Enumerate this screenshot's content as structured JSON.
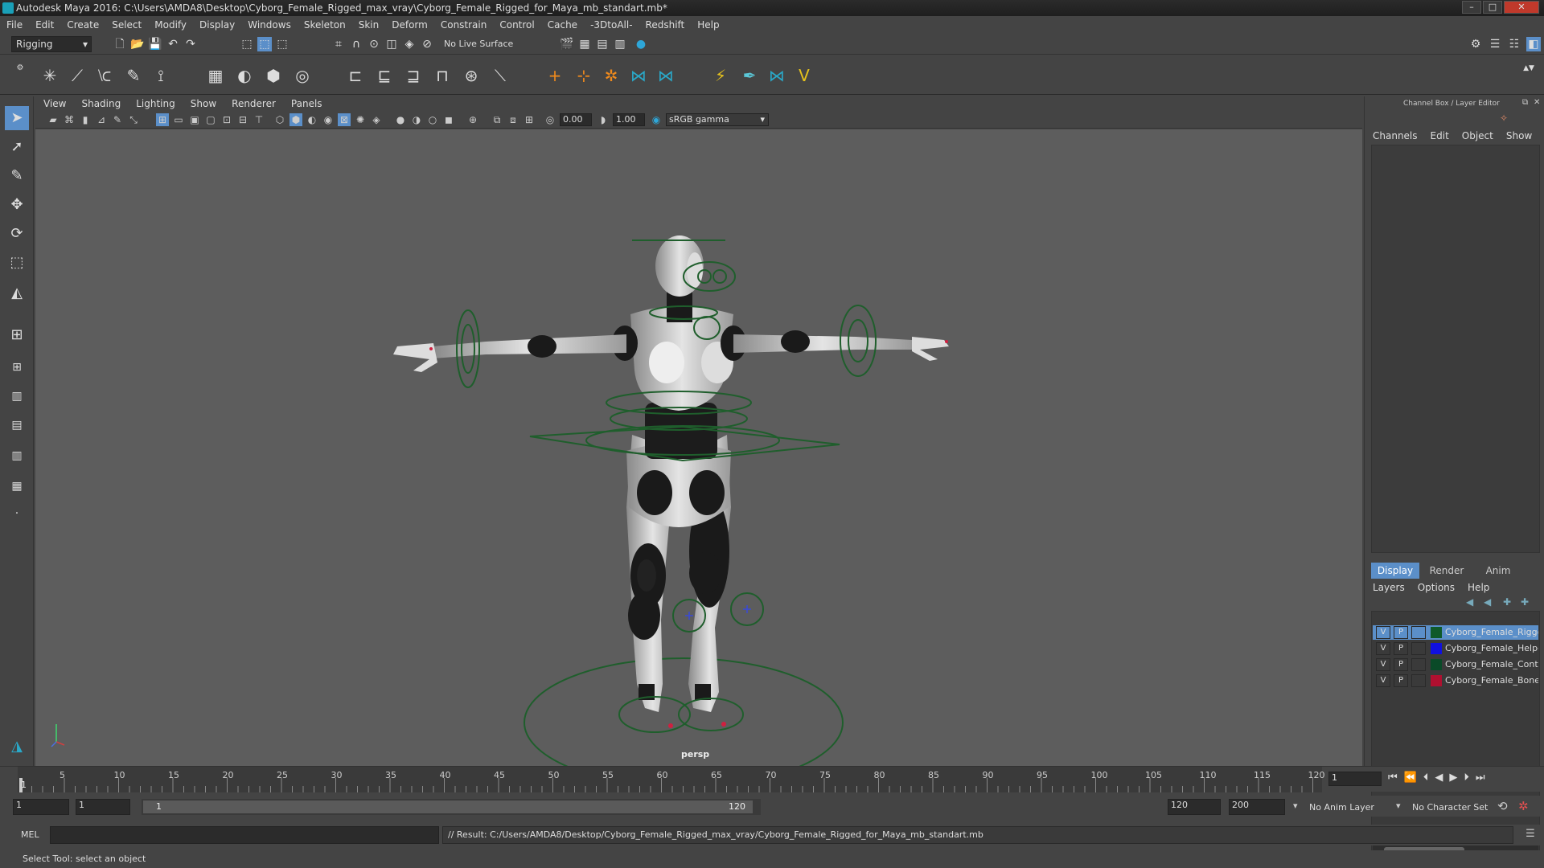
{
  "window": {
    "title": "Autodesk Maya 2016: C:\\Users\\AMDA8\\Desktop\\Cyborg_Female_Rigged_max_vray\\Cyborg_Female_Rigged_for_Maya_mb_standart.mb*",
    "controls": [
      "–",
      "□",
      "✕"
    ]
  },
  "menubar": [
    "File",
    "Edit",
    "Create",
    "Select",
    "Modify",
    "Display",
    "Windows",
    "Skeleton",
    "Skin",
    "Deform",
    "Constrain",
    "Control",
    "Cache",
    "-3DtoAll-",
    "Redshift",
    "Help"
  ],
  "statusline": {
    "menuset": "Rigging",
    "live_surface": "No Live Surface"
  },
  "panel": {
    "menus": [
      "View",
      "Shading",
      "Lighting",
      "Show",
      "Renderer",
      "Panels"
    ],
    "exposure": "0.00",
    "gamma": "1.00",
    "color_space": "sRGB gamma",
    "camera": "persp"
  },
  "channel_box": {
    "title": "Channel Box / Layer Editor",
    "menus": [
      "Channels",
      "Edit",
      "Object",
      "Show"
    ]
  },
  "layer_editor": {
    "tabs": [
      "Display",
      "Render",
      "Anim"
    ],
    "menus": [
      "Layers",
      "Options",
      "Help"
    ],
    "layers": [
      {
        "v": "V",
        "p": "P",
        "name": "Cyborg_Female_Rigge",
        "color": "#0f5a2a",
        "selected": true
      },
      {
        "v": "V",
        "p": "P",
        "name": "Cyborg_Female_Helpe",
        "color": "#1010e0",
        "selected": false
      },
      {
        "v": "V",
        "p": "P",
        "name": "Cyborg_Female_Contr",
        "color": "#0a4a28",
        "selected": false
      },
      {
        "v": "V",
        "p": "P",
        "name": "Cyborg_Female_Bones",
        "color": "#b01030",
        "selected": false
      }
    ]
  },
  "timeline": {
    "ticks": [
      "5",
      "10",
      "15",
      "20",
      "25",
      "30",
      "35",
      "40",
      "45",
      "50",
      "55",
      "60",
      "65",
      "70",
      "75",
      "80",
      "85",
      "90",
      "95",
      "100",
      "105",
      "110",
      "115",
      "120"
    ],
    "current_marker": "1",
    "current_frame": "1"
  },
  "range": {
    "start": "1",
    "playback_start": "1",
    "range_start_label": "1",
    "range_end_label": "120",
    "playback_end": "120",
    "end": "200",
    "anim_layer": "No Anim Layer",
    "character_set": "No Character Set"
  },
  "command": {
    "language": "MEL",
    "result": "// Result: C:/Users/AMDA8/Desktop/Cyborg_Female_Rigged_max_vray/Cyborg_Female_Rigged_for_Maya_mb_standart.mb"
  },
  "helpline": "Select Tool: select an object",
  "colors": {
    "viewport_bg": "#5d5d5d",
    "control_curve": "#1f5e2c",
    "selection_highlight": "#5b8fc9"
  }
}
